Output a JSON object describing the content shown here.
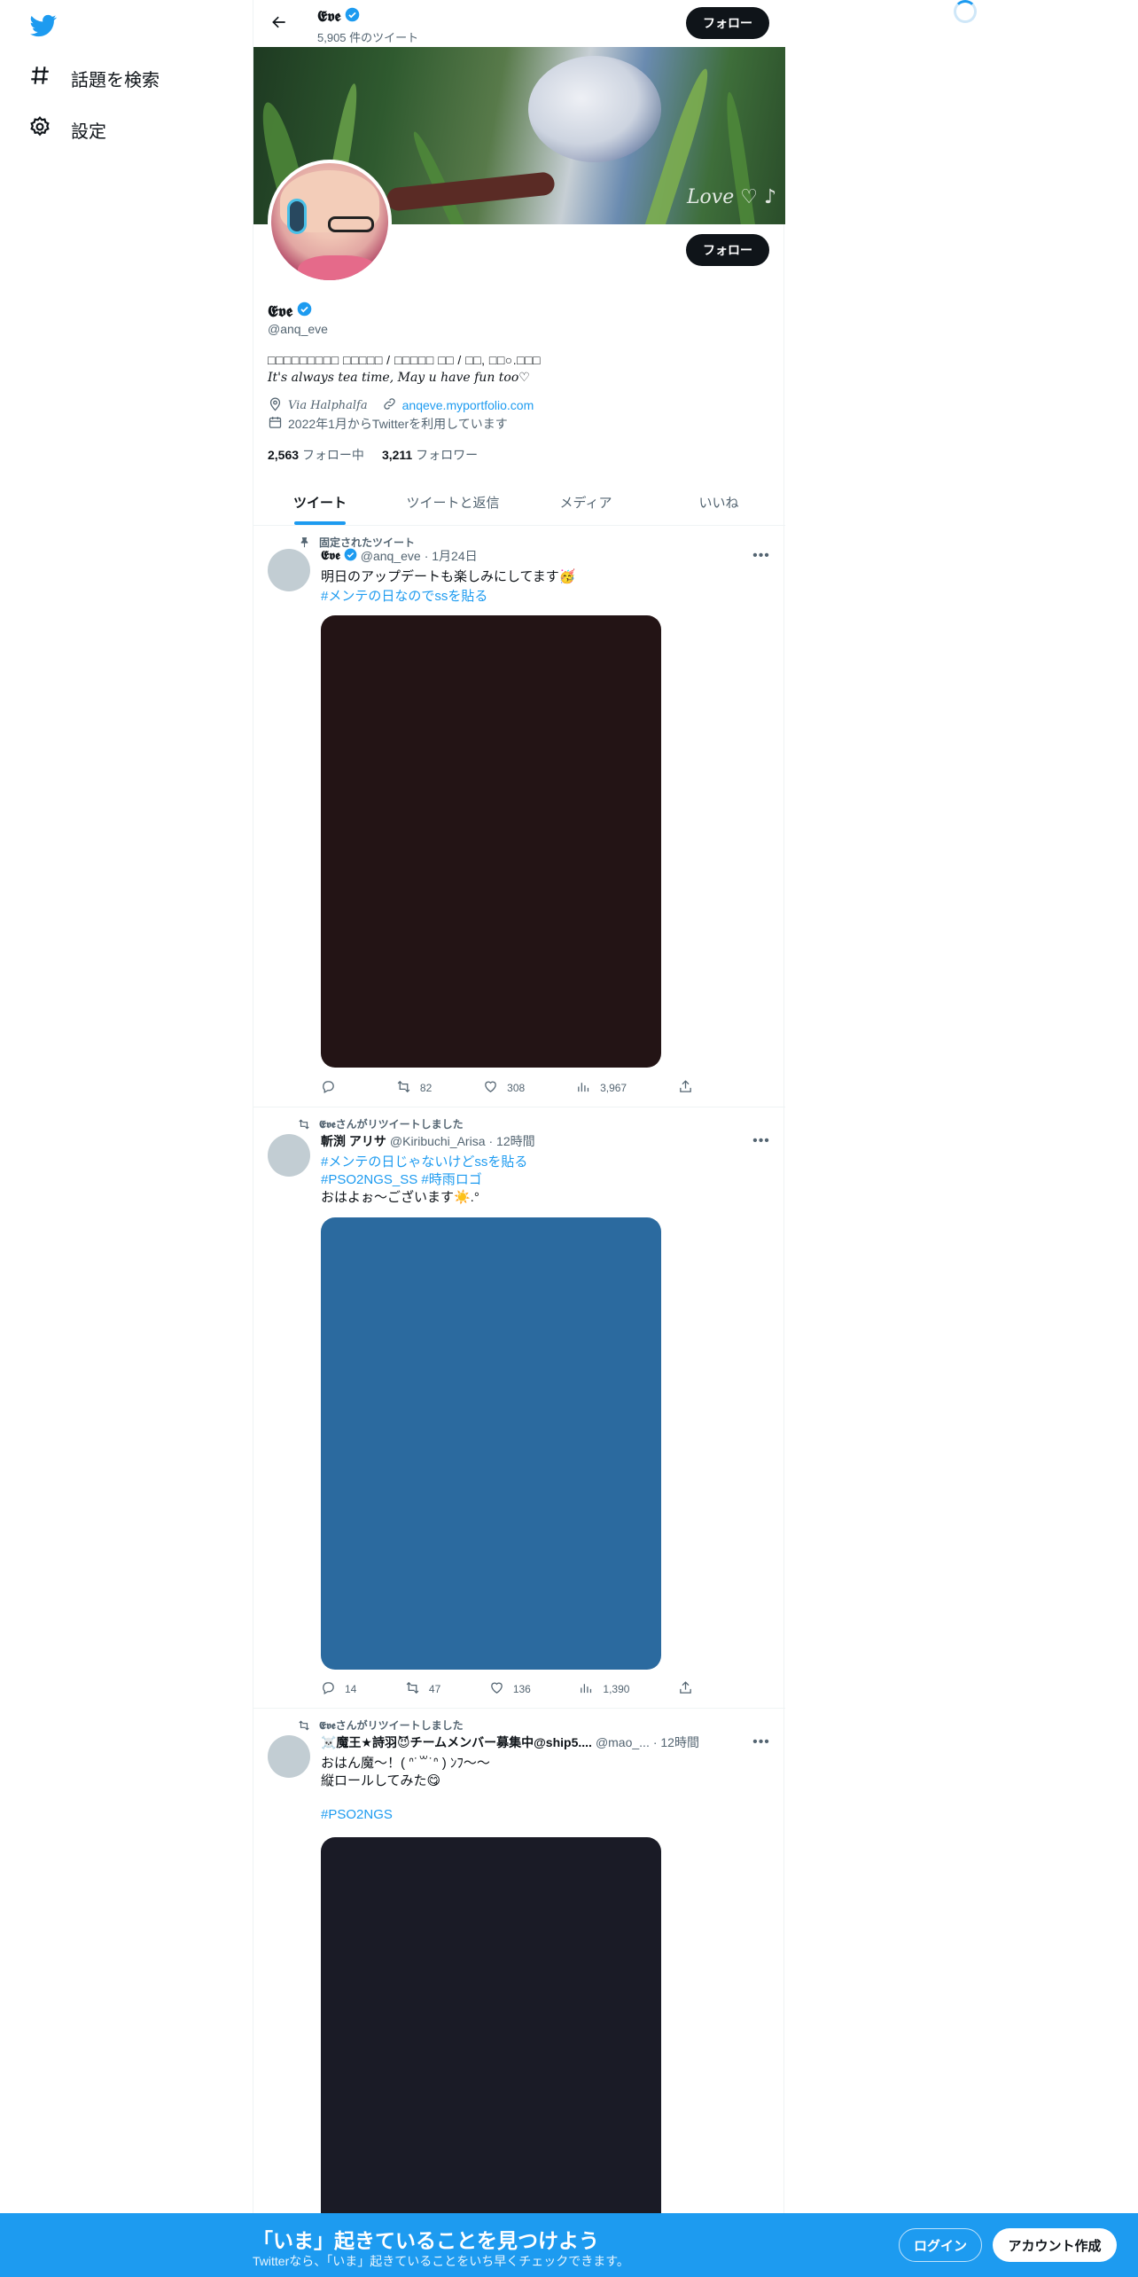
{
  "sidebar": {
    "items": [
      {
        "label": "話題を検索",
        "icon": "hashtag-icon"
      },
      {
        "label": "設定",
        "icon": "gear-icon"
      }
    ]
  },
  "header": {
    "name": "𝕰𝖛𝖊",
    "tweet_count": "5,905 件のツイート",
    "follow_label": "フォロー"
  },
  "profile": {
    "name": "𝕰𝖛𝖊",
    "handle": "@anq_eve",
    "bio_line1": "□□□□□□□□□ □□□□□ / □□□□□ □□ / □□, □□○.□□□",
    "bio_line2": "It's always tea time, May u have fun too♡",
    "location": "Via Halphalfa",
    "url": "anqeve.myportfolio.com",
    "joined": "2022年1月からTwitterを利用しています",
    "following_count": "2,563",
    "following_label": "フォロー中",
    "followers_count": "3,211",
    "followers_label": "フォロワー",
    "follow_label": "フォロー",
    "banner_signature": "Love ♡ ♪"
  },
  "tabs": [
    "ツイート",
    "ツイートと返信",
    "メディア",
    "いいね"
  ],
  "tweets": [
    {
      "context": "固定されたツイート",
      "name": "𝕰𝖛𝖊",
      "handle": "@anq_eve",
      "time": "· 1月24日",
      "lines": [
        "明日のアップデートも楽しみにしてます🥳"
      ],
      "tags": [
        "#メンテの日なのでssを貼る"
      ],
      "media_color": "#231415",
      "replies": "",
      "retweets": "82",
      "likes": "308",
      "views": "3,967"
    },
    {
      "context": "𝕰𝖛𝖊さんがリツイートしました",
      "name": "斬渕 アリサ",
      "handle": "@Kiribuchi_Arisa",
      "time": "· 12時間",
      "tags": [
        "#メンテの日じゃないけどssを貼る",
        "#PSO2NGS_SS #時雨ロゴ"
      ],
      "lines": [
        "おはよぉ〜ございます☀️.°"
      ],
      "media_color": "#2b6a9f",
      "replies": "14",
      "retweets": "47",
      "likes": "136",
      "views": "1,390"
    },
    {
      "context": "𝕰𝖛𝖊さんがリツイートしました",
      "name": "☠️魔王★詩羽😈チームメンバー募集中@ship5....",
      "handle": "@mao_...",
      "time": "· 12時間",
      "lines": [
        "おはん魔～！( ᐢ˙꒳˙ᐢ ) ﾝﾌ〜〜",
        "縦ロールしてみた😋"
      ],
      "tags": [
        "#PSO2NGS"
      ],
      "media_color": "#1a1b26"
    }
  ],
  "bottom_bar": {
    "title": "「いま」起きていることを見つけよう",
    "subtitle": "Twitterなら、「いま」起きていることをいち早くチェックできます。",
    "login": "ログイン",
    "signup": "アカウント作成"
  },
  "colors": {
    "accent": "#1d9bf0",
    "text": "#0f1419",
    "muted": "#536471"
  }
}
